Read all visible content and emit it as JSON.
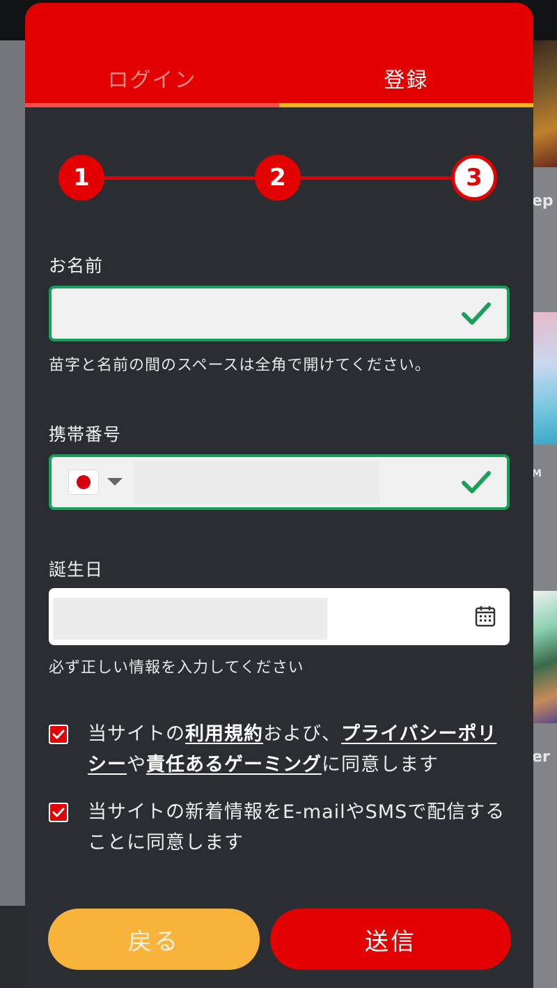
{
  "background": {
    "right_labels": [
      "ep",
      "M",
      "er"
    ]
  },
  "tabs": {
    "login_label": "ログイン",
    "register_label": "登録",
    "active": "register"
  },
  "stepper": {
    "steps": [
      "1",
      "2",
      "3"
    ],
    "current": "3"
  },
  "form": {
    "name": {
      "label": "お名前",
      "value": "",
      "hint": "苗字と名前の間のスペースは全角で開けてください。",
      "status": "valid"
    },
    "phone": {
      "label": "携帯番号",
      "country_flag": "japan-flag-icon",
      "value": "",
      "status": "valid"
    },
    "birthday": {
      "label": "誕生日",
      "value": "",
      "hint": "必ず正しい情報を入力してください"
    }
  },
  "consents": {
    "terms": {
      "checked": true,
      "prefix": "当サイトの",
      "terms_link": "利用規約",
      "and_text": "および、",
      "privacy_link": "プライバシーポリシー",
      "ya_text": "や",
      "responsible_link": "責任あるゲーミング",
      "suffix": "に同意します"
    },
    "newsletter": {
      "checked": true,
      "text": "当サイトの新着情報をE-mailやSMSで配信することに同意します"
    }
  },
  "buttons": {
    "back_label": "戻る",
    "submit_label": "送信"
  },
  "colors": {
    "brand_red": "#e20000",
    "accent_yellow": "#f7b33a",
    "valid_green": "#16a05a",
    "panel_bg": "#2a2d31"
  }
}
